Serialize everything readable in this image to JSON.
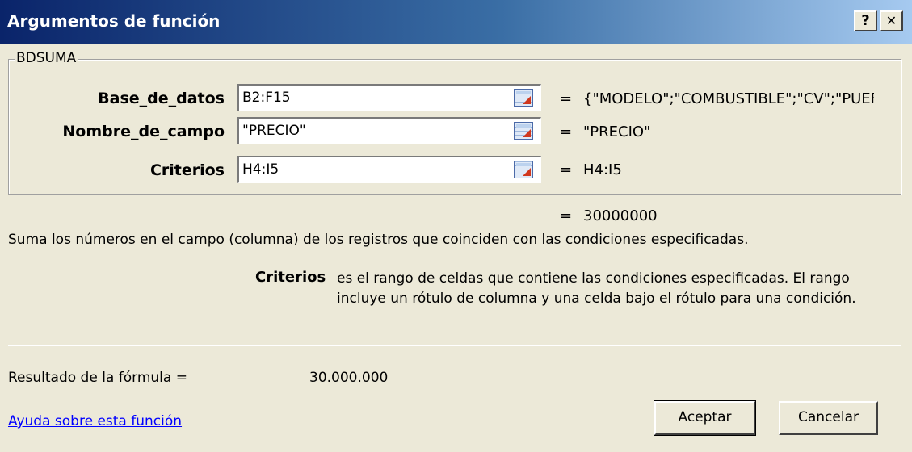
{
  "window": {
    "title": "Argumentos de función",
    "help_label": "?",
    "close_label": "✕"
  },
  "function": {
    "name": "BDSUMA",
    "arguments": [
      {
        "label": "Base_de_datos",
        "input": "B2:F15",
        "equals": "=",
        "value": "{\"MODELO\";\"COMBUSTIBLE\";\"CV\";\"PUEF"
      },
      {
        "label": "Nombre_de_campo",
        "input": "\"PRECIO\"",
        "equals": "=",
        "value": "\"PRECIO\""
      },
      {
        "label": "Criterios",
        "input": "H4:I5",
        "equals": "=",
        "value": "H4:I5"
      }
    ],
    "result_equals": "=",
    "result_value": "30000000",
    "description": "Suma los números en el campo (columna) de los registros que coinciden con las condiciones especificadas.",
    "active_argument": "Criterios",
    "active_argument_description": "es el rango de celdas que contiene las condiciones especificadas. El rango incluye un rótulo de columna y una celda bajo el rótulo para una condición."
  },
  "result": {
    "label": "Resultado de la fórmula =",
    "value": "30.000.000"
  },
  "footer": {
    "help_link": "Ayuda sobre esta función",
    "ok_label": "Aceptar",
    "cancel_label": "Cancelar"
  },
  "colors": {
    "title_start": "#0a246a",
    "title_end": "#a6caf0",
    "dialog_bg": "#ece9d8",
    "link": "#0000ff"
  },
  "icons": {
    "ref_button": "collapse-dialog-icon"
  }
}
